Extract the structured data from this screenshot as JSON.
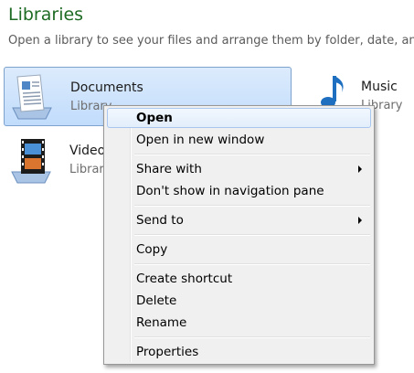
{
  "header": {
    "title": "Libraries",
    "subtitle": "Open a library to see your files and arrange them by folder, date, and"
  },
  "libraries": [
    {
      "name": "Documents",
      "type": "Library",
      "icon": "documents-library-icon",
      "selected": true
    },
    {
      "name": "Music",
      "type": "Library",
      "icon": "music-library-icon",
      "selected": false
    },
    {
      "name": "Videos",
      "type": "Library",
      "icon": "videos-library-icon",
      "selected": false
    }
  ],
  "context_menu": {
    "items": [
      {
        "label": "Open",
        "default": true,
        "hover": true,
        "submenu": false
      },
      {
        "label": "Open in new window",
        "default": false,
        "hover": false,
        "submenu": false
      },
      {
        "label": "Share with",
        "default": false,
        "hover": false,
        "submenu": true
      },
      {
        "label": "Don't show in navigation pane",
        "default": false,
        "hover": false,
        "submenu": false
      },
      {
        "label": "Send to",
        "default": false,
        "hover": false,
        "submenu": true
      },
      {
        "label": "Copy",
        "default": false,
        "hover": false,
        "submenu": false
      },
      {
        "label": "Create shortcut",
        "default": false,
        "hover": false,
        "submenu": false
      },
      {
        "label": "Delete",
        "default": false,
        "hover": false,
        "submenu": false
      },
      {
        "label": "Rename",
        "default": false,
        "hover": false,
        "submenu": false
      },
      {
        "label": "Properties",
        "default": false,
        "hover": false,
        "submenu": false
      }
    ]
  },
  "colors": {
    "title_green": "#1e6b24",
    "selection_blue": "#c1dcfc",
    "menu_background": "#f0f0f0"
  }
}
